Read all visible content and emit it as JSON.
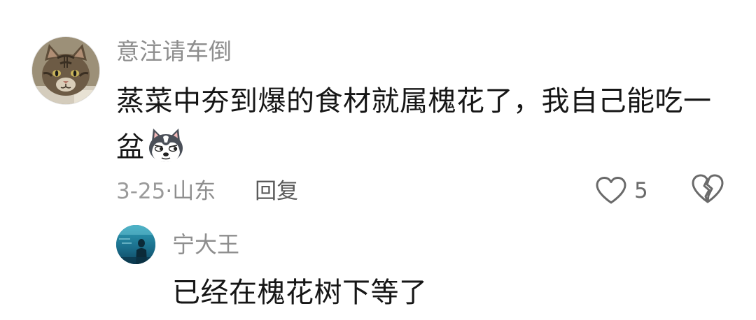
{
  "comment": {
    "username": "意注请车倒",
    "text": "蒸菜中夯到爆的食材就属槐花了，我自己能吃一盆",
    "sticker_icon": "husky-dog-sticker",
    "date": "3-25",
    "separator": "·",
    "location": "山东",
    "reply_label": "回复",
    "like_count": "5",
    "avatar_icon": "tabby-cat-avatar"
  },
  "reply": {
    "username": "宁大王",
    "text": "已经在槐花树下等了",
    "avatar_icon": "underwater-aquarium-avatar"
  }
}
